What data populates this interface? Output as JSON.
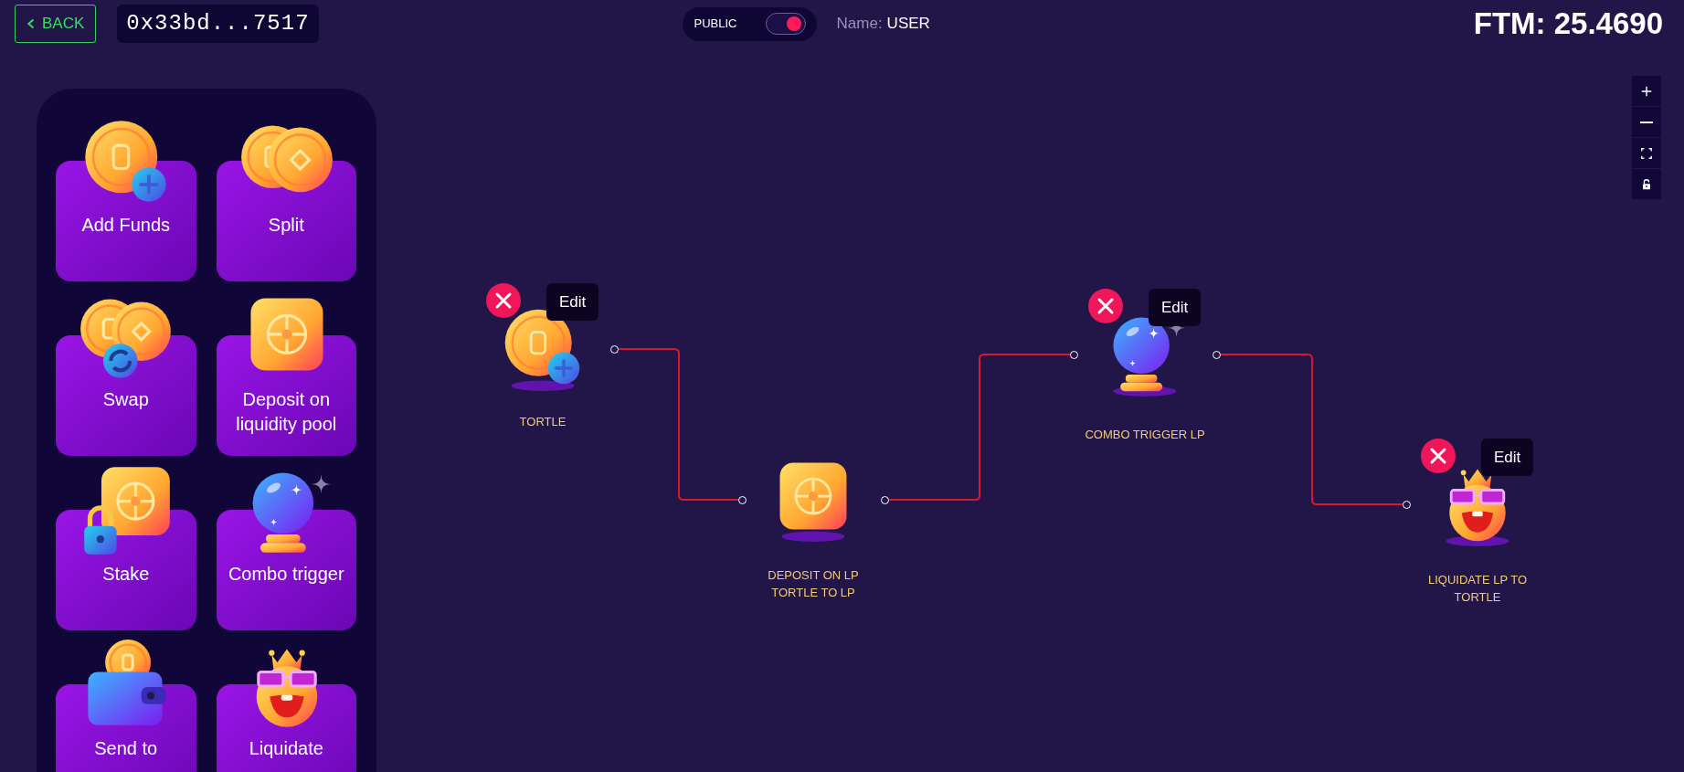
{
  "header": {
    "back_button": "BACK",
    "wallet_address": "0x33bd...7517",
    "visibility": {
      "label": "PUBLIC",
      "on": true
    },
    "name_label": "Name:",
    "name_value": "USER",
    "balance": "FTM: 25.4690"
  },
  "palette": [
    {
      "label": "Add Funds",
      "kind": "add-funds"
    },
    {
      "label": "Split",
      "kind": "split"
    },
    {
      "label": "Swap",
      "kind": "swap"
    },
    {
      "label": "Deposit on liquidity pool",
      "kind": "deposit"
    },
    {
      "label": "Stake",
      "kind": "stake"
    },
    {
      "label": "Combo trigger",
      "kind": "combo"
    },
    {
      "label": "Send to",
      "kind": "send"
    },
    {
      "label": "Liquidate",
      "kind": "liquidate"
    }
  ],
  "flow": {
    "nodes": [
      {
        "label": "TORTLE",
        "kind": "add-funds",
        "selected": true,
        "edit": "Edit"
      },
      {
        "label": "DEPOSIT ON LP TORTLE TO LP",
        "kind": "deposit",
        "selected": false
      },
      {
        "label": "COMBO TRIGGER LP",
        "kind": "combo",
        "selected": true,
        "edit": "Edit"
      },
      {
        "label": "LIQUIDATE LP TO TORTLE",
        "kind": "liquidate",
        "selected": true,
        "edit": "Edit"
      }
    ]
  },
  "zoom_controls": [
    {
      "kind": "zoom-in"
    },
    {
      "kind": "zoom-out"
    },
    {
      "kind": "fit"
    },
    {
      "kind": "lock"
    }
  ]
}
